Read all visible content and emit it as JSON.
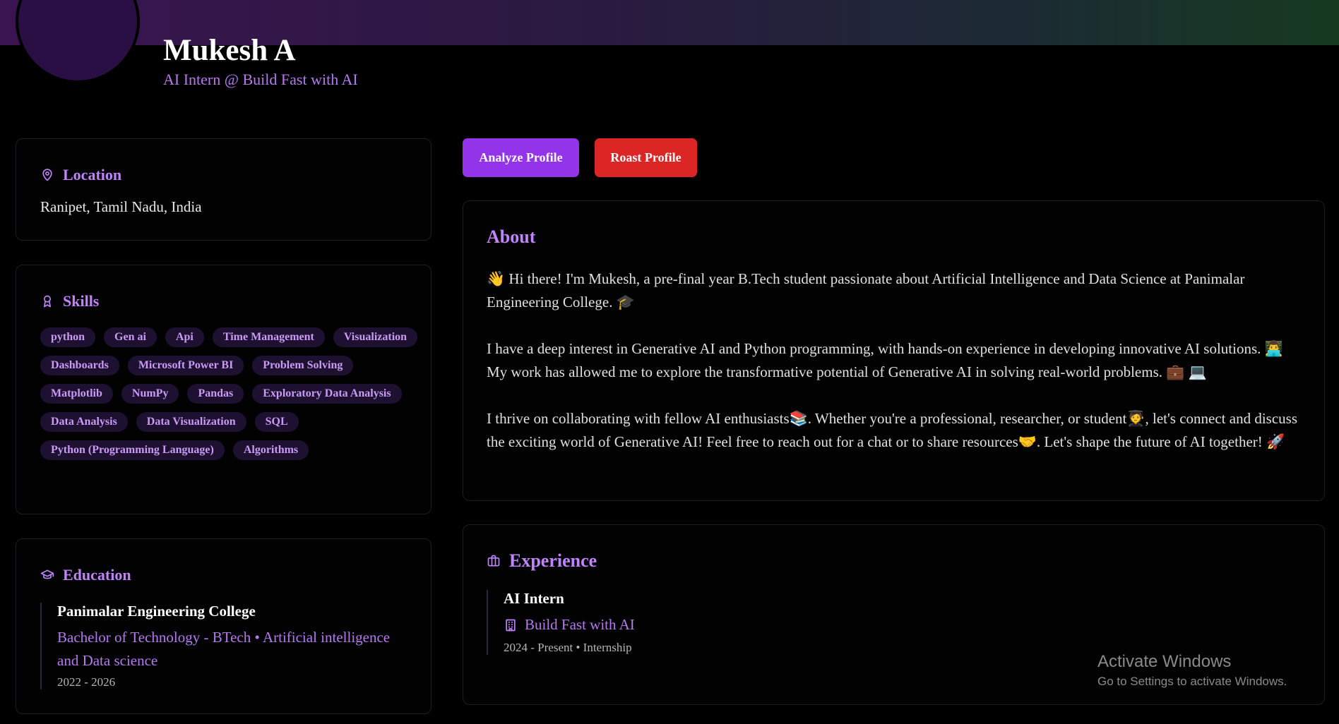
{
  "profile": {
    "name": "Mukesh A",
    "headline": "AI Intern @ Build Fast with AI"
  },
  "actions": {
    "analyze_label": "Analyze Profile",
    "roast_label": "Roast Profile"
  },
  "location": {
    "title": "Location",
    "value": "Ranipet, Tamil Nadu, India"
  },
  "skills": {
    "title": "Skills",
    "items": [
      "python",
      "Gen ai",
      "Api",
      "Time Management",
      "Visualization",
      "Dashboards",
      "Microsoft Power BI",
      "Problem Solving",
      "Matplotlib",
      "NumPy",
      "Pandas",
      "Exploratory Data Analysis",
      "Data Analysis",
      "Data Visualization",
      "SQL",
      "Python (Programming Language)",
      "Algorithms"
    ]
  },
  "education": {
    "title": "Education",
    "entries": [
      {
        "school": "Panimalar Engineering College",
        "degree": "Bachelor of Technology - BTech • Artificial intelligence and Data science",
        "years": "2022 - 2026"
      }
    ]
  },
  "about": {
    "title": "About",
    "paragraphs": [
      "👋 Hi there! I'm Mukesh, a pre-final year B.Tech student passionate about Artificial Intelligence and Data Science at Panimalar Engineering College. 🎓",
      "I have a deep interest in Generative AI and Python programming, with hands-on experience in developing innovative AI solutions. 👨‍💻 My work has allowed me to explore the transformative potential of Generative AI in solving real-world problems. 💼 💻",
      "I thrive on collaborating with fellow AI enthusiasts📚. Whether you're a professional, researcher, or student🧑‍🎓, let's connect and discuss the exciting world of Generative AI! Feel free to reach out for a chat or to share resources🤝. Let's shape the future of AI together! 🚀"
    ]
  },
  "experience": {
    "title": "Experience",
    "entries": [
      {
        "role": "AI Intern",
        "company": "Build Fast with AI",
        "meta": "2024 - Present • Internship"
      }
    ]
  },
  "watermark": {
    "title": "Activate Windows",
    "subtitle": "Go to Settings to activate Windows."
  }
}
